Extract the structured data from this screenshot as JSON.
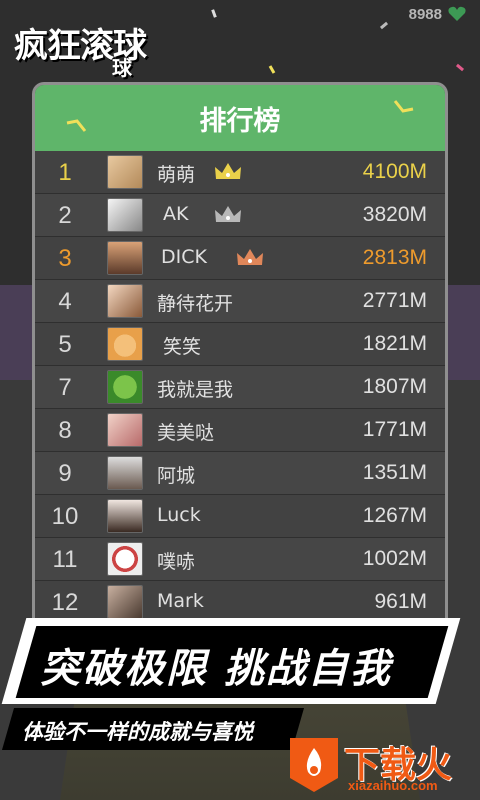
{
  "app": {
    "logo_main": "疯狂滚球",
    "logo_sub": "球",
    "top_score": "8988"
  },
  "leaderboard": {
    "title": "排行榜",
    "rows": [
      {
        "rank": "1",
        "name": "萌萌",
        "distance": "4100M",
        "crown": "gold"
      },
      {
        "rank": "2",
        "name": "AK",
        "distance": "3820M",
        "crown": "silver"
      },
      {
        "rank": "3",
        "name": "DICK",
        "distance": "2813M",
        "crown": "bronze"
      },
      {
        "rank": "4",
        "name": "静待花开",
        "distance": "2771M"
      },
      {
        "rank": "5",
        "name": "笑笑",
        "distance": "1821M"
      },
      {
        "rank": "7",
        "name": "我就是我",
        "distance": "1807M"
      },
      {
        "rank": "8",
        "name": "美美哒",
        "distance": "1771M"
      },
      {
        "rank": "9",
        "name": "阿城",
        "distance": "1351M"
      },
      {
        "rank": "10",
        "name": "Luck",
        "distance": "1267M"
      },
      {
        "rank": "11",
        "name": "噗哧",
        "distance": "1002M"
      },
      {
        "rank": "12",
        "name": "Mark",
        "distance": "961M"
      }
    ]
  },
  "slogan": {
    "main": "突破极限 挑战自我",
    "sub": "体验不一样的成就与喜悦"
  },
  "watermark": {
    "text": "下载火",
    "url": "xiazaihuo.com"
  },
  "colors": {
    "header_green": "#5fb56a",
    "gold": "#ead14a",
    "orange": "#ee9b2d",
    "watermark": "#f05a14"
  }
}
